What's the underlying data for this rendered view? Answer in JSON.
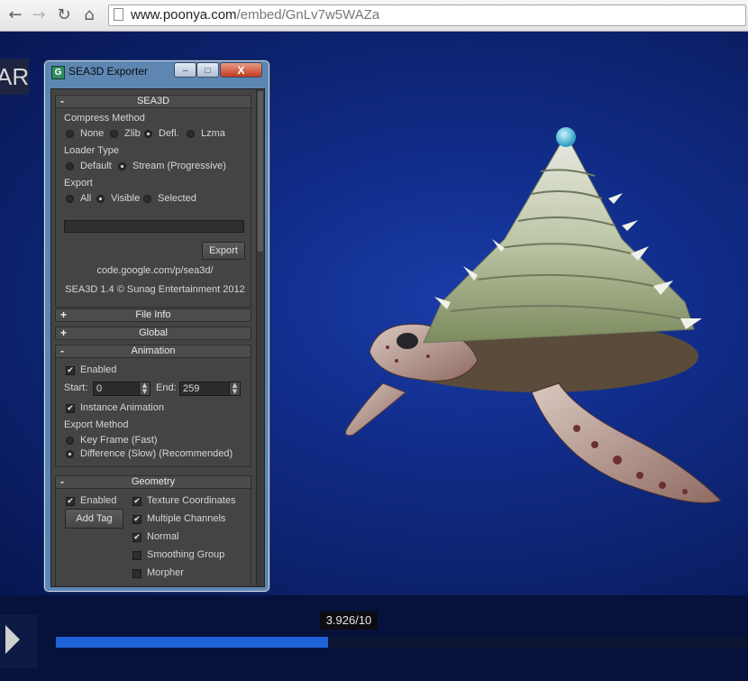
{
  "browser": {
    "back_icon": "←",
    "forward_icon": "→",
    "reload_icon": "↻",
    "home_icon": "⌂",
    "url_host": "www.poonya.com",
    "url_path": "/embed/GnLv7w5WAZa"
  },
  "stage": {
    "badge_text": "AR",
    "background_accent": "#1a3ca8"
  },
  "player": {
    "time_label": "3.926/10",
    "progress_fraction": 0.3926,
    "play_icon": "play-icon"
  },
  "exporter": {
    "title": "SEA3D Exporter",
    "app_icon_letter": "G",
    "min_label": "–",
    "max_label": "□",
    "close_label": "X",
    "sea3d": {
      "sign": "-",
      "title": "SEA3D",
      "compress_label": "Compress Method",
      "compress_options": [
        {
          "label": "None",
          "selected": false
        },
        {
          "label": "Zlib",
          "selected": false
        },
        {
          "label": "Defl.",
          "selected": true
        },
        {
          "label": "Lzma",
          "selected": false
        }
      ],
      "loader_label": "Loader Type",
      "loader_options": [
        {
          "label": "Default",
          "selected": false
        },
        {
          "label": "Stream (Progressive)",
          "selected": true
        }
      ],
      "export_label": "Export",
      "export_options": [
        {
          "label": "All",
          "selected": false
        },
        {
          "label": "Visible",
          "selected": true
        },
        {
          "label": "Selected",
          "selected": false
        }
      ],
      "export_button": "Export",
      "link": "code.google.com/p/sea3d/",
      "credit": "SEA3D 1.4 © Sunag Entertainment 2012"
    },
    "file_info": {
      "sign": "+",
      "title": "File Info"
    },
    "global": {
      "sign": "+",
      "title": "Global"
    },
    "animation": {
      "sign": "-",
      "title": "Animation",
      "enabled_label": "Enabled",
      "enabled_checked": true,
      "start_label": "Start:",
      "start_value": "0",
      "end_label": "End:",
      "end_value": "259",
      "instance_label": "Instance Animation",
      "instance_checked": true,
      "method_label": "Export Method",
      "method_options": [
        {
          "label": "Key Frame (Fast)",
          "selected": false
        },
        {
          "label": "Difference (Slow) (Recommended)",
          "selected": true
        }
      ]
    },
    "geometry": {
      "sign": "-",
      "title": "Geometry",
      "enabled_label": "Enabled",
      "enabled_checked": true,
      "add_tag_button": "Add Tag",
      "options": [
        {
          "label": "Texture Coordinates",
          "checked": true
        },
        {
          "label": "Multiple Channels",
          "checked": true
        },
        {
          "label": "Normal",
          "checked": true
        },
        {
          "label": "Smoothing Group",
          "checked": false
        },
        {
          "label": "Morpher",
          "checked": false
        }
      ]
    }
  }
}
